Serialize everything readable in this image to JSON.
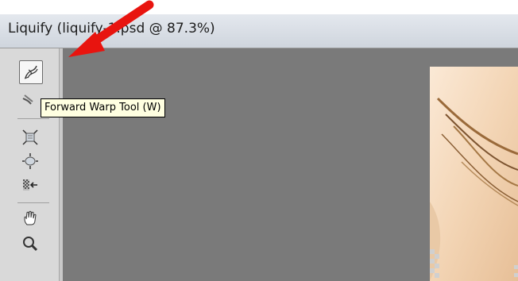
{
  "window": {
    "title": "Liquify (liquify-1.psd @ 87.3%)"
  },
  "toolbar": {
    "tools": [
      {
        "name": "forward-warp-icon",
        "selected": true
      },
      {
        "name": "reconstruct-icon",
        "selected": false
      },
      {
        "name": "pucker-icon",
        "selected": false
      },
      {
        "name": "bloat-icon",
        "selected": false
      },
      {
        "name": "push-left-icon",
        "selected": false
      },
      {
        "name": "hand-icon",
        "selected": false
      },
      {
        "name": "zoom-icon",
        "selected": false
      }
    ]
  },
  "tooltip": {
    "text": "Forward Warp Tool (W)"
  },
  "annotation": {
    "arrow_color": "#e8140f"
  },
  "colors": {
    "canvas": "#7a7a7a",
    "tooltip_bg": "#ffffe1"
  }
}
